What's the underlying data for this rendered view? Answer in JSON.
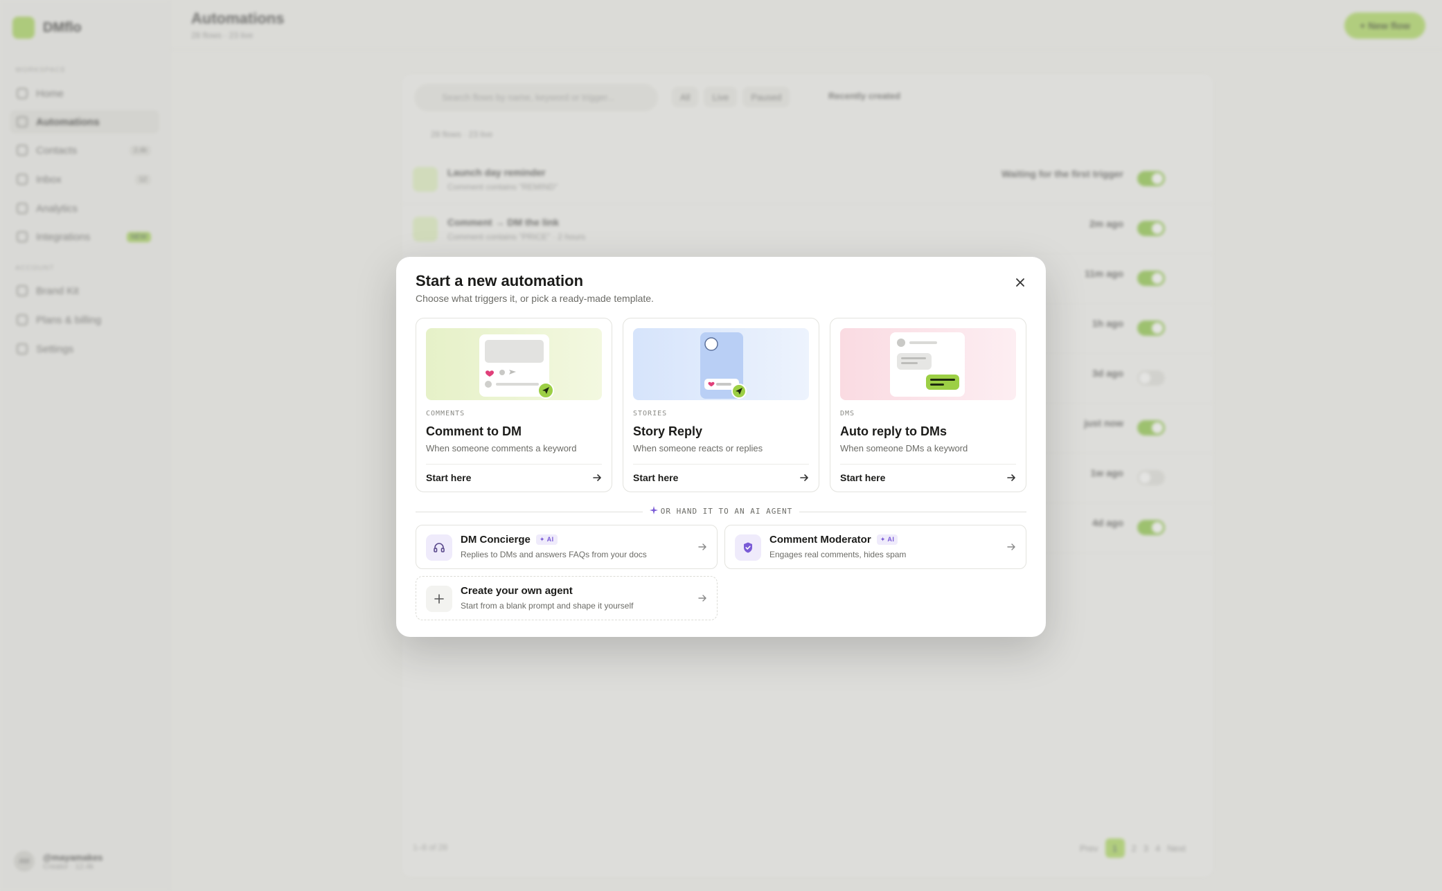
{
  "app": {
    "brand": "DMflo",
    "sections": {
      "workspace": "WORKSPACE",
      "account": "ACCOUNT"
    },
    "nav": [
      {
        "label": "Home",
        "badge": ""
      },
      {
        "label": "Automations",
        "badge": ""
      },
      {
        "label": "Contacts",
        "badge": "2.4k"
      },
      {
        "label": "Inbox",
        "badge": "12"
      },
      {
        "label": "Analytics",
        "badge": ""
      },
      {
        "label": "Integrations",
        "badge": "NEW"
      },
      {
        "label": "Brand Kit",
        "badge": ""
      },
      {
        "label": "Plans & billing",
        "badge": ""
      },
      {
        "label": "Settings",
        "badge": ""
      }
    ],
    "user": {
      "initials": "AM",
      "name": "@mayamakes",
      "sub": "Creator · 12.4k"
    },
    "page_title": "Automations",
    "page_sub": "28 flows · 23 live",
    "new_flow": "+ New flow",
    "search_placeholder": "Search flows by name, keyword or trigger...",
    "chips": [
      "All",
      "Live",
      "Paused"
    ],
    "sort": "Recently created",
    "count": "28 flows · 23 live",
    "rows": [
      {
        "title": "Launch day reminder",
        "sub": "Comment contains \"REMIND\"",
        "stat": "Waiting for the first trigger",
        "on": true
      },
      {
        "title": "Comment → DM the link",
        "sub": "Comment contains \"PRICE\" · 2 hours",
        "stat": "2m ago",
        "on": true
      },
      {
        "title": "",
        "sub": "",
        "stat": "11m ago",
        "on": true
      },
      {
        "title": "",
        "sub": "",
        "stat": "1h ago",
        "on": true
      },
      {
        "title": "",
        "sub": "",
        "stat": "3d ago",
        "on": false
      },
      {
        "title": "",
        "sub": "",
        "stat": "just now",
        "on": true
      },
      {
        "title": "",
        "sub": "",
        "stat": "1w ago",
        "on": false
      },
      {
        "title": "",
        "sub": "",
        "stat": "4d ago",
        "on": true
      }
    ],
    "pager": {
      "range": "1–8 of 28",
      "prev": "Prev",
      "pages": [
        "1",
        "2",
        "3",
        "4"
      ],
      "next": "Next"
    }
  },
  "modal": {
    "title": "Start a new automation",
    "subtitle": "Choose what triggers it, or pick a ready-made template.",
    "cards": [
      {
        "tag": "COMMENTS",
        "title": "Comment to DM",
        "desc": "When someone comments a keyword",
        "cta": "Start here"
      },
      {
        "tag": "STORIES",
        "title": "Story Reply",
        "desc": "When someone reacts or replies",
        "cta": "Start here"
      },
      {
        "tag": "DMS",
        "title": "Auto reply to DMs",
        "desc": "When someone DMs a keyword",
        "cta": "Start here"
      }
    ],
    "divider": "OR HAND IT TO AN AI AGENT",
    "agents": [
      {
        "name": "DM Concierge",
        "badge": "AI",
        "desc": "Replies to DMs and answers FAQs from your docs"
      },
      {
        "name": "Comment Moderator",
        "badge": "AI",
        "desc": "Engages real comments, hides spam"
      },
      {
        "name": "Create your own agent",
        "badge": "",
        "desc": "Start from a blank prompt and shape it yourself"
      }
    ]
  },
  "colors": {
    "accent": "#a3d64a",
    "ai": "#7a5bd6"
  }
}
